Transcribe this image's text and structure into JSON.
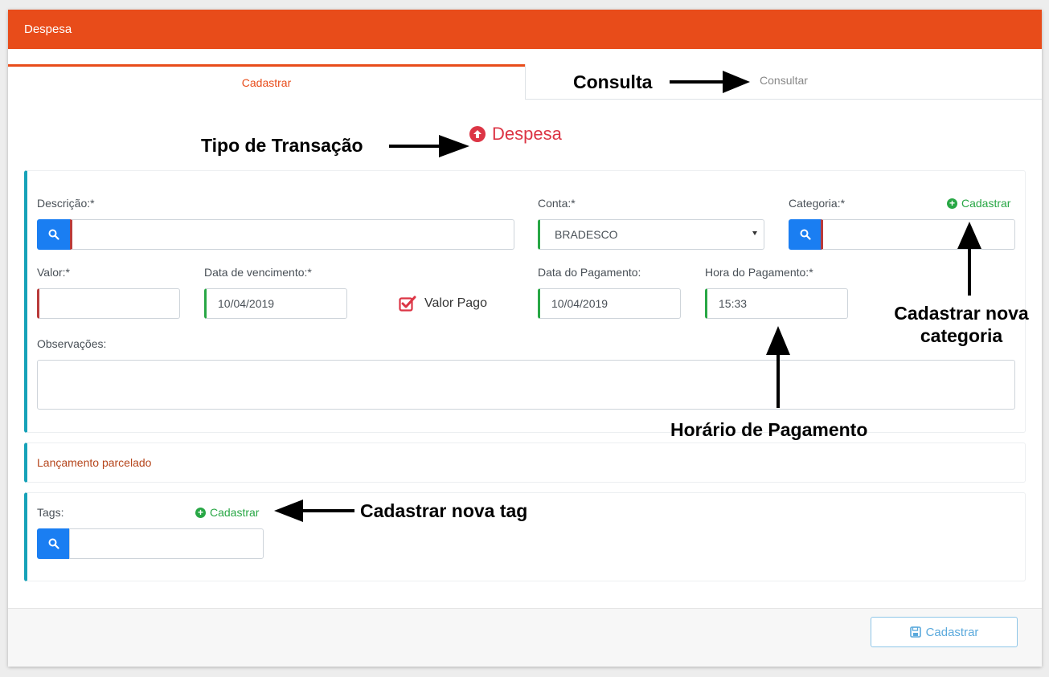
{
  "header": {
    "title": "Despesa"
  },
  "tabs": [
    {
      "label": "Cadastrar",
      "active": true
    },
    {
      "label": "Consultar",
      "active": false
    }
  ],
  "transaction_type": {
    "label": "Despesa",
    "icon": "arrow-up-circle-icon",
    "color": "#dc3545"
  },
  "form": {
    "descricao": {
      "label": "Descrição:*",
      "value": ""
    },
    "conta": {
      "label": "Conta:*",
      "value": "BRADESCO"
    },
    "categoria": {
      "label": "Categoria:*",
      "value": "",
      "add_label": "Cadastrar"
    },
    "valor": {
      "label": "Valor:*",
      "value": ""
    },
    "data_vencimento": {
      "label": "Data de vencimento:*",
      "value": "10/04/2019"
    },
    "valor_pago": {
      "label": "Valor Pago",
      "checked": true
    },
    "data_pagamento": {
      "label": "Data do Pagamento:",
      "value": "10/04/2019"
    },
    "hora_pagamento": {
      "label": "Hora do Pagamento:*",
      "value": "15:33"
    },
    "observacoes": {
      "label": "Observações:",
      "value": ""
    }
  },
  "installments": {
    "label": "Lançamento parcelado"
  },
  "tags": {
    "label": "Tags:",
    "add_label": "Cadastrar",
    "value": ""
  },
  "footer": {
    "submit_label": "Cadastrar"
  },
  "annotations": {
    "consulta": "Consulta",
    "tipo_transacao": "Tipo de Transação",
    "nova_categoria_line1": "Cadastrar nova",
    "nova_categoria_line2": "categoria",
    "horario": "Horário de Pagamento",
    "nova_tag": "Cadastrar nova tag"
  },
  "colors": {
    "brand": "#e84c1a",
    "primary": "#1a7ef2",
    "success": "#28a745",
    "info": "#17a2b8",
    "danger": "#dc3545"
  }
}
